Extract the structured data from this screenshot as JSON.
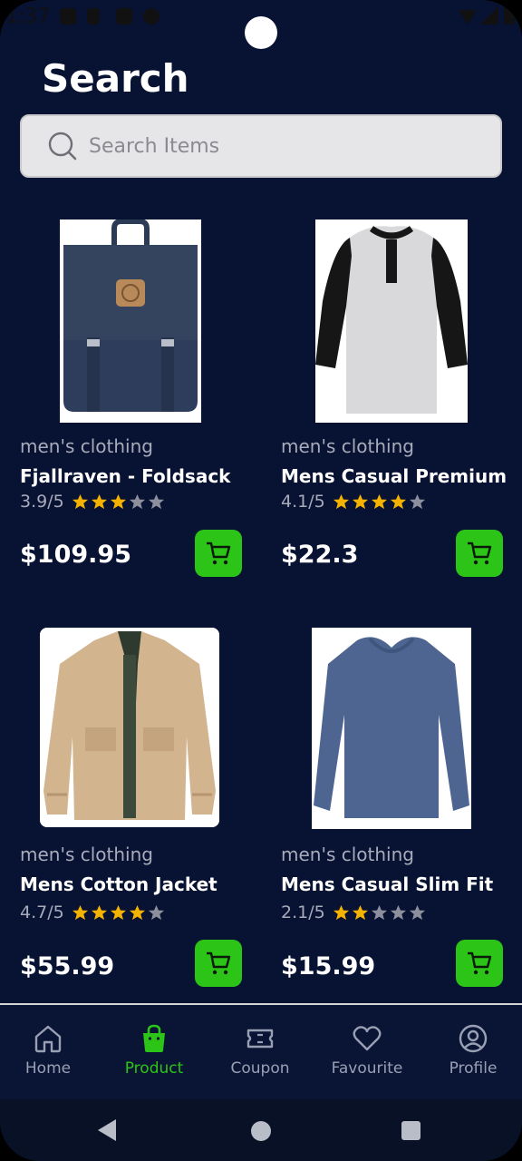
{
  "status_bar": {
    "time": "1:37"
  },
  "header": {
    "title": "Search"
  },
  "search": {
    "placeholder": "Search Items"
  },
  "products": [
    {
      "category": "men's clothing",
      "name": "Fjallraven - Foldsack",
      "rating_text": "3.9/5",
      "stars": 3,
      "price": "$109.95",
      "image": "backpack"
    },
    {
      "category": "men's clothing",
      "name": "Mens Casual Premium",
      "rating_text": "4.1/5",
      "stars": 4,
      "price": "$22.3",
      "image": "raglan-shirt"
    },
    {
      "category": "men's clothing",
      "name": "Mens Cotton Jacket",
      "rating_text": "4.7/5",
      "stars": 4,
      "price": "$55.99",
      "image": "cotton-jacket"
    },
    {
      "category": "men's clothing",
      "name": "Mens Casual Slim Fit",
      "rating_text": "2.1/5",
      "stars": 2,
      "price": "$15.99",
      "image": "long-sleeve-tee"
    }
  ],
  "bottom_nav": {
    "items": [
      {
        "label": "Home",
        "icon": "home-icon",
        "active": false
      },
      {
        "label": "Product",
        "icon": "bag-icon",
        "active": true
      },
      {
        "label": "Coupon",
        "icon": "ticket-icon",
        "active": false
      },
      {
        "label": "Favourite",
        "icon": "heart-icon",
        "active": false
      },
      {
        "label": "Profile",
        "icon": "user-icon",
        "active": false
      }
    ]
  },
  "colors": {
    "background": "#081233",
    "accent": "#2bc417",
    "star_filled": "#f5b301",
    "star_empty": "#8d909c"
  }
}
